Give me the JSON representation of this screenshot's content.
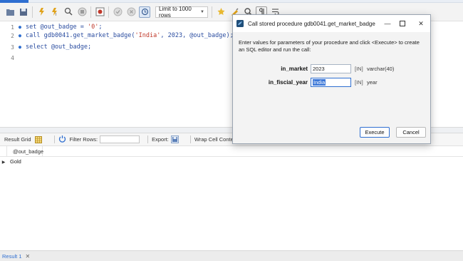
{
  "toolbar": {
    "limit_value": "Limit to 1000 rows",
    "icons": [
      "open-icon",
      "save-icon",
      "execute-icon",
      "execute-current-icon",
      "explain-icon",
      "stop-icon",
      "toggle-result-icon",
      "stop-on-error-icon",
      "commit-icon",
      "rollback-icon",
      "autocommit-icon",
      "limit-select",
      "beautify-icon",
      "find-icon",
      "search-icon",
      "invisible-chars-icon",
      "wrap-icon"
    ]
  },
  "editor": {
    "lines": [
      {
        "num": "1",
        "pre": "set @out_badge = ",
        "str": "'0'",
        "post": ";"
      },
      {
        "num": "2",
        "pre": "call gdb0041.get_market_badge(",
        "str": "'India'",
        "post": ", 2023, @out_badge);"
      },
      {
        "num": "3",
        "pre": "select @out_badge;",
        "str": "",
        "post": ""
      },
      {
        "num": "4",
        "pre": "",
        "str": "",
        "post": ""
      }
    ]
  },
  "result_toolbar": {
    "result_grid": "Result Grid",
    "filter_rows": "Filter Rows:",
    "export": "Export:",
    "wrap_cell": "Wrap Cell Content:"
  },
  "grid": {
    "columns": [
      "@out_badge"
    ],
    "rows": [
      [
        "Gold"
      ]
    ]
  },
  "bottom_tabs": [
    {
      "label": "Result 1"
    }
  ],
  "dialog": {
    "title": "Call stored procedure gdb0041.get_market_badge",
    "description": "Enter values for parameters of your procedure and click <Execute> to create an SQL editor and run the call:",
    "params": [
      {
        "name": "in_market",
        "value": "2023",
        "direction": "[IN]",
        "type": "varchar(40)"
      },
      {
        "name": "in_fiscial_year",
        "value": "India",
        "direction": "[IN]",
        "type": "year"
      }
    ],
    "execute_label": "Execute",
    "cancel_label": "Cancel"
  },
  "colors": {
    "accent": "#2f6fd1",
    "string": "#c0392b",
    "keyword": "#2b4da0"
  }
}
